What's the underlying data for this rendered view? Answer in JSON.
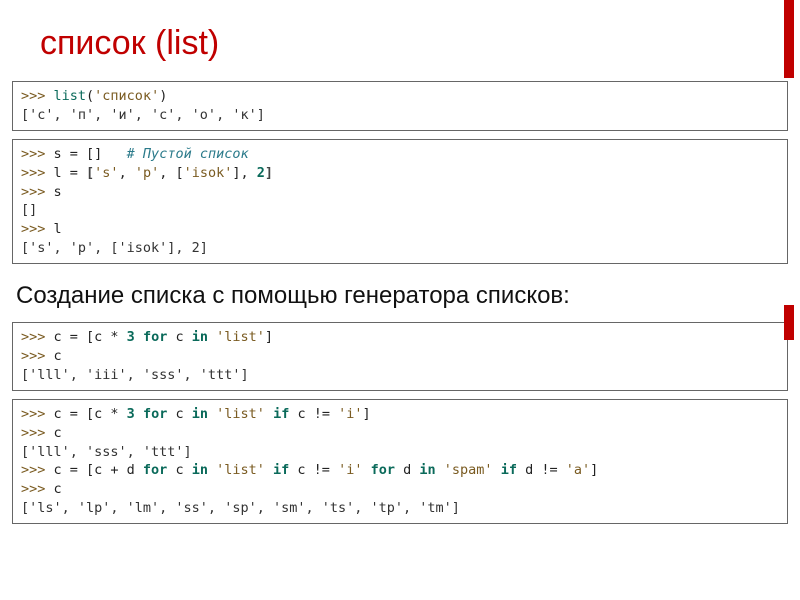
{
  "title": "список (list)",
  "subtitle": "Создание списка с помощью генератора списков:",
  "prompt": ">>> ",
  "box1": {
    "l1_func": "list",
    "l1_open": "(",
    "l1_str": "'список'",
    "l1_close": ")",
    "out": "['с', 'п', 'и', 'с', 'о', 'к']"
  },
  "box2": {
    "l1_text": "s = [] ",
    "l1_comment": "  # Пустой список",
    "l2_a": "l = ",
    "l2_b": "[",
    "l2_c": "'s'",
    "l2_d": ", ",
    "l2_e": "'p'",
    "l2_f": ", [",
    "l2_g": "'isok'",
    "l2_h": "], ",
    "l2_i": "2",
    "l2_j": "]",
    "l3": "s",
    "out3": "[]",
    "l4": "l",
    "out4": "['s', 'p', ['isok'], 2]"
  },
  "box3": {
    "l1_a": "c = [c * ",
    "l1_b": "3",
    "l1_c": " ",
    "l1_for": "for",
    "l1_d": " c ",
    "l1_in": "in",
    "l1_e": " ",
    "l1_str": "'list'",
    "l1_f": "]",
    "l2": "c",
    "out": "['lll', 'iii', 'sss', 'ttt']"
  },
  "box4": {
    "l1_a": "c = [c * ",
    "l1_b": "3",
    "l1_c": " ",
    "l1_for": "for",
    "l1_d": " c ",
    "l1_in": "in",
    "l1_e": " ",
    "l1_s1": "'list'",
    "l1_f": " ",
    "l1_if": "if",
    "l1_g": " c != ",
    "l1_s2": "'i'",
    "l1_h": "]",
    "l2": "c",
    "out2": "['lll', 'sss', 'ttt']",
    "l3_a": "c = [c + d ",
    "l3_for1": "for",
    "l3_b": " c ",
    "l3_in1": "in",
    "l3_c": " ",
    "l3_s1": "'list'",
    "l3_d": " ",
    "l3_if1": "if",
    "l3_e": " c != ",
    "l3_s2": "'i'",
    "l3_f": " ",
    "l3_for2": "for",
    "l3_g": " d ",
    "l3_in2": "in",
    "l3_h": " ",
    "l3_s3": "'spam'",
    "l3_i": " ",
    "l3_if2": "if",
    "l3_j": " d != ",
    "l3_s4": "'a'",
    "l3_k": "]",
    "l4": "c",
    "out4": "['ls', 'lp', 'lm', 'ss', 'sp', 'sm', 'ts', 'tp', 'tm']"
  }
}
